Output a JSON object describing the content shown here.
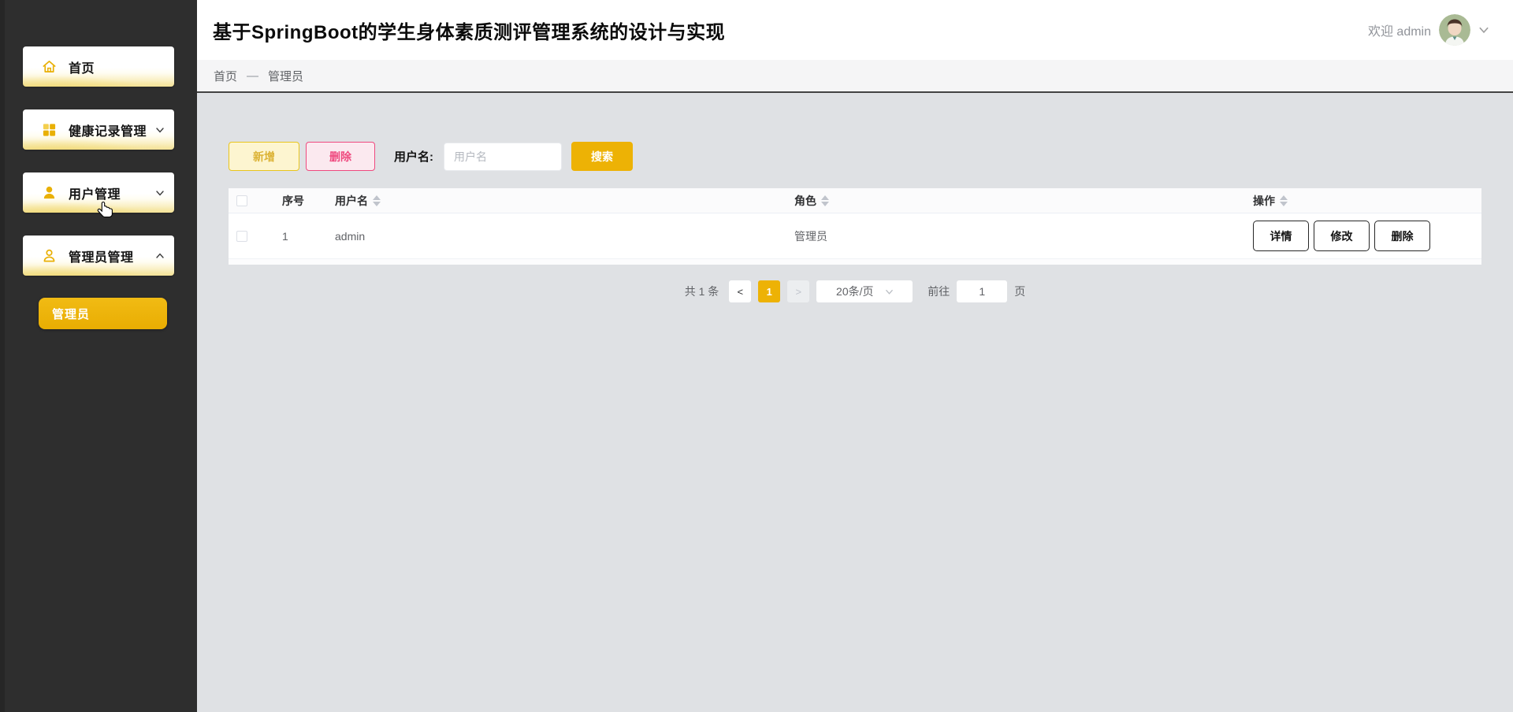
{
  "app": {
    "title": "基于SpringBoot的学生身体素质测评管理系统的设计与实现",
    "welcome": "欢迎 admin"
  },
  "sidebar": {
    "items": [
      {
        "label": "首页",
        "icon": "home-icon",
        "state": "none"
      },
      {
        "label": "健康记录管理",
        "icon": "grid-icon",
        "state": "collapsed"
      },
      {
        "label": "用户管理",
        "icon": "user-solid-icon",
        "state": "collapsed"
      },
      {
        "label": "管理员管理",
        "icon": "user-outline-icon",
        "state": "expanded"
      }
    ],
    "submenu": {
      "label": "管理员",
      "active": true
    }
  },
  "breadcrumb": {
    "home": "首页",
    "separator": "—",
    "current": "管理员"
  },
  "toolbar": {
    "add_label": "新增",
    "delete_label": "删除",
    "username_label": "用户名:",
    "search_placeholder": "用户名",
    "search_label": "搜索"
  },
  "table": {
    "headers": {
      "index": "序号",
      "username": "用户名",
      "role": "角色",
      "actions": "操作"
    },
    "rows": [
      {
        "index": "1",
        "username": "admin",
        "role": "管理员"
      }
    ],
    "row_actions": {
      "detail": "详情",
      "edit": "修改",
      "delete": "删除"
    }
  },
  "pagination": {
    "total": "共 1 条",
    "prev": "<",
    "current_page": "1",
    "next": ">",
    "page_size": "20条/页",
    "goto_label": "前往",
    "goto_value": "1",
    "page_unit": "页"
  },
  "colors": {
    "accent": "#edb205",
    "danger": "#ef4a7f",
    "sidebar_bg": "#2e2e2e",
    "content_bg": "#dfe1e4"
  }
}
